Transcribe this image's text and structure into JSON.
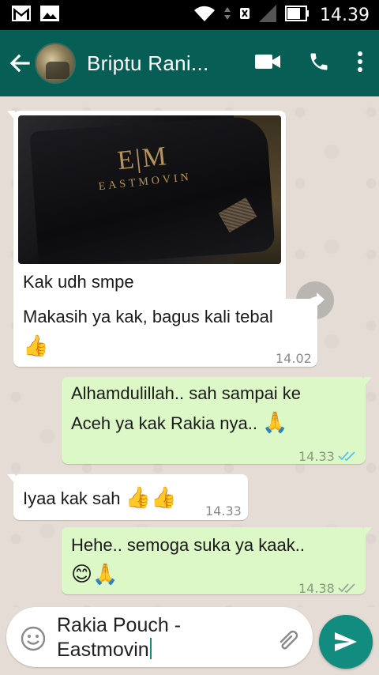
{
  "status_bar": {
    "time": "14.39",
    "icons": [
      "gmail-icon",
      "gallery-icon",
      "wifi-icon",
      "no-sim-icon",
      "signal-icon",
      "battery-icon"
    ]
  },
  "header": {
    "contact_name": "Briptu Rani...",
    "icons": [
      "back-arrow-icon",
      "video-call-icon",
      "phone-icon",
      "more-vert-icon"
    ]
  },
  "messages": [
    {
      "direction": "in",
      "type": "image",
      "caption": "Kak udh smpe",
      "time": "14.02",
      "photo_logo_mark": "E|M",
      "photo_logo_word": "EASTMOVIN"
    },
    {
      "direction": "in",
      "type": "text",
      "text": "Makasih ya kak, bagus kali tebal",
      "emoji": "👍",
      "time": "14.02"
    },
    {
      "direction": "out",
      "type": "text",
      "line1": "Alhamdulillah.. sah sampai ke",
      "line2": "Aceh ya kak Rakia nya..",
      "emoji": "🙏",
      "time": "14.33",
      "status": "read"
    },
    {
      "direction": "in",
      "type": "text",
      "text": "Iyaa kak sah",
      "emoji": "👍👍",
      "time": "14.33"
    },
    {
      "direction": "out",
      "type": "text",
      "text": "Hehe.. semoga suka ya kaak..",
      "emoji": "😊🙏",
      "time": "14.38",
      "status": "delivered"
    }
  ],
  "composer": {
    "line1": "Rakia Pouch -",
    "line2": "Eastmovin",
    "icons": [
      "emoji-icon",
      "attach-icon",
      "send-icon"
    ]
  },
  "colors": {
    "header": "#075e54",
    "send_button": "#128c7e",
    "outgoing_bubble": "#dcf8c6",
    "incoming_bubble": "#ffffff",
    "read_tick": "#4fc3f7",
    "chat_background": "#e5ddd5"
  }
}
